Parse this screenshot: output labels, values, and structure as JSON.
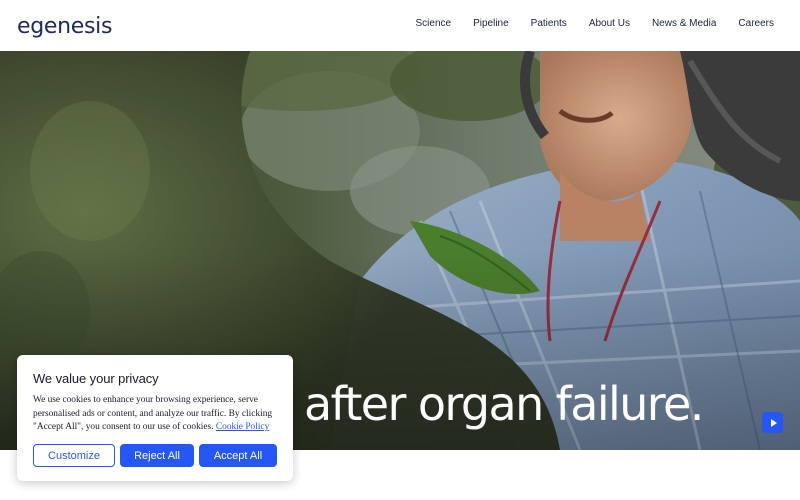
{
  "brand": {
    "logo_text": "egenesis",
    "accent_color": "#2457f5",
    "logo_color": "#1f2a63"
  },
  "nav": {
    "items": [
      {
        "label": "Science"
      },
      {
        "label": "Pipeline"
      },
      {
        "label": "Patients"
      },
      {
        "label": "About Us"
      },
      {
        "label": "News & Media"
      },
      {
        "label": "Careers"
      }
    ]
  },
  "hero": {
    "headline": "after organ failure.",
    "play_icon": "play-icon"
  },
  "cookie_banner": {
    "title": "We value your privacy",
    "body": "We use cookies to enhance your browsing experience, serve personalised ads or content, and analyze our traffic. By clicking \"Accept All\", you consent to our use of cookies.",
    "link_label": "Cookie Policy",
    "buttons": {
      "customize": "Customize",
      "reject": "Reject All",
      "accept": "Accept All"
    }
  }
}
